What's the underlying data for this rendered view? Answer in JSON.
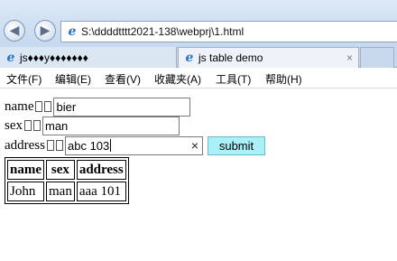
{
  "browser": {
    "address": "S:\\ddddtttt2021-138\\webprj\\1.html",
    "tabs": [
      {
        "label": "js\u0000\u0000\u0000y\u0000\u0000\u0000\u0000\u0000\u0000\u0000",
        "display": "js♦♦♦y♦♦♦♦♦♦♦",
        "active": false
      },
      {
        "label": "js table demo",
        "active": true
      }
    ],
    "tab_close": "×",
    "menu": [
      "文件(F)",
      "编辑(E)",
      "查看(V)",
      "收藏夹(A)",
      "工具(T)",
      "帮助(H)"
    ]
  },
  "form": {
    "name_label": "name",
    "name_value": "bier",
    "sex_label": "sex",
    "sex_value": "man",
    "address_label": "address",
    "address_value": "abc 103",
    "clear_glyph": "×",
    "submit_label": "submit"
  },
  "table": {
    "headers": [
      "name",
      "sex",
      "address"
    ],
    "rows": [
      [
        "John",
        "man",
        "aaa 101"
      ]
    ]
  },
  "colors": {
    "submit_bg": "#aaf0f8",
    "ie_blue": "#2a73c9"
  }
}
